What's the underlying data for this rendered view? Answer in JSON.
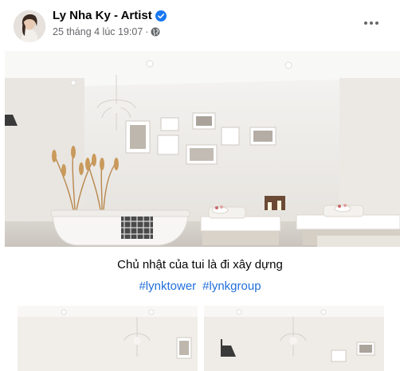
{
  "post": {
    "author": "Ly Nha Ky - Artist",
    "timestamp": "25 tháng 4 lúc 19:07",
    "separator": "·",
    "caption": "Chủ nhật của tui là đi xây dựng",
    "hashtags": [
      "#lynktower",
      "#lynkgroup"
    ]
  },
  "icons": {
    "verified": "verified-badge-icon",
    "privacy": "globe-icon",
    "more": "more-options-icon"
  },
  "colors": {
    "link": "#216fdb",
    "meta_text": "#65676b",
    "verified": "#1877f2"
  }
}
